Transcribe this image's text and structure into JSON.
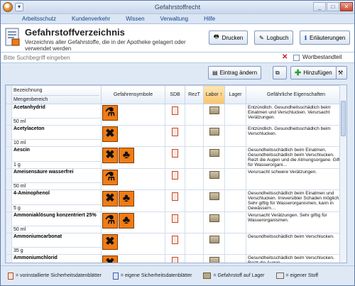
{
  "window": {
    "title": "Gefahrstoffrecht"
  },
  "menu": [
    "Arbeitsschutz",
    "Kundenverkehr",
    "Wissen",
    "Verwaltung",
    "Hilfe"
  ],
  "header": {
    "title": "Gefahrstoffverzeichnis",
    "subtitle": "Verzeichnis aller Gefahrstoffe, die in der Apotheke gelagert oder verwendet werden",
    "buttons": {
      "print": "Drucken",
      "logbook": "Logbuch",
      "explain": "Erläuterungen"
    }
  },
  "search": {
    "placeholder": "Bitte Suchbegriff eingeben",
    "checkbox_label": "Wortbestandteil"
  },
  "toolbar": {
    "edit": "Eintrag ändern",
    "add": "Hinzufügen"
  },
  "table": {
    "columns": {
      "name": "Bezeichnung",
      "range": "Mengenbereich",
      "symbols": "Gefahrensymbole",
      "sdb": "SDB",
      "rezt": "RezT",
      "labor": "Labor",
      "lager": "Lager",
      "props": "Gefährliche Eigenschaften"
    },
    "rows": [
      {
        "name": "Acetanhydrid",
        "range": "50 ml",
        "symbols": [
          "corrosive"
        ],
        "props": "Entzündlich. Gesundheitsschädlich beim Einatmen und Verschlucken. Verursacht Verätzungen."
      },
      {
        "name": "Acetylaceton",
        "range": "10 ml",
        "symbols": [
          "harmful"
        ],
        "props": "Entzündlich. Gesundheitsschädlich beim Verschlucken."
      },
      {
        "name": "Aescin",
        "range": "1 g",
        "symbols": [
          "harmful",
          "environment"
        ],
        "props": "Gesundheitsschädlich beim Einatmen. Gesundheitsschädlich beim Verschlucken. Reizt die Augen und die Atmungsorgane. Giftig für Wasserorgani…"
      },
      {
        "name": "Ameisensäure wasserfrei",
        "range": "50 ml",
        "symbols": [
          "corrosive"
        ],
        "props": "Verursacht schwere Verätzungen."
      },
      {
        "name": "4-Aminophenol",
        "range": "5 g",
        "symbols": [
          "harmful",
          "environment"
        ],
        "props": "Gesundheitsschädlich beim Einatmen und Verschlucken. Irreversibler Schaden möglich. Sehr giftig für Wasserorganismen, kann in Gewässern…"
      },
      {
        "name": "Ammoniaklösung konzentriert 25%",
        "range": "50 ml",
        "symbols": [
          "corrosive",
          "environment"
        ],
        "props": "Verursacht Verätzungen. Sehr giftig für Wasserorganismen."
      },
      {
        "name": "Ammoniumcarbonat",
        "range": "35 g",
        "symbols": [
          "harmful"
        ],
        "props": "Gesundheitsschädlich beim Verschlucken."
      },
      {
        "name": "Ammoniumchlorid",
        "range": "",
        "symbols": [
          "harmful"
        ],
        "props": "Gesundheitsschädlich beim Verschlucken. Reizt die Augen."
      }
    ]
  },
  "legend": {
    "preinstalled": "= vorinstallierte Sicherheitsdatenblätter",
    "own_sheets": "= eigene Sicherheitsdatenblätter",
    "in_storage": "= Gefahrstoff auf Lager",
    "own_substance": "= eigener Stoff"
  },
  "colors": {
    "accent": "#15428b",
    "hazard": "#f07b14",
    "sorted_header": "#f8c46a"
  }
}
